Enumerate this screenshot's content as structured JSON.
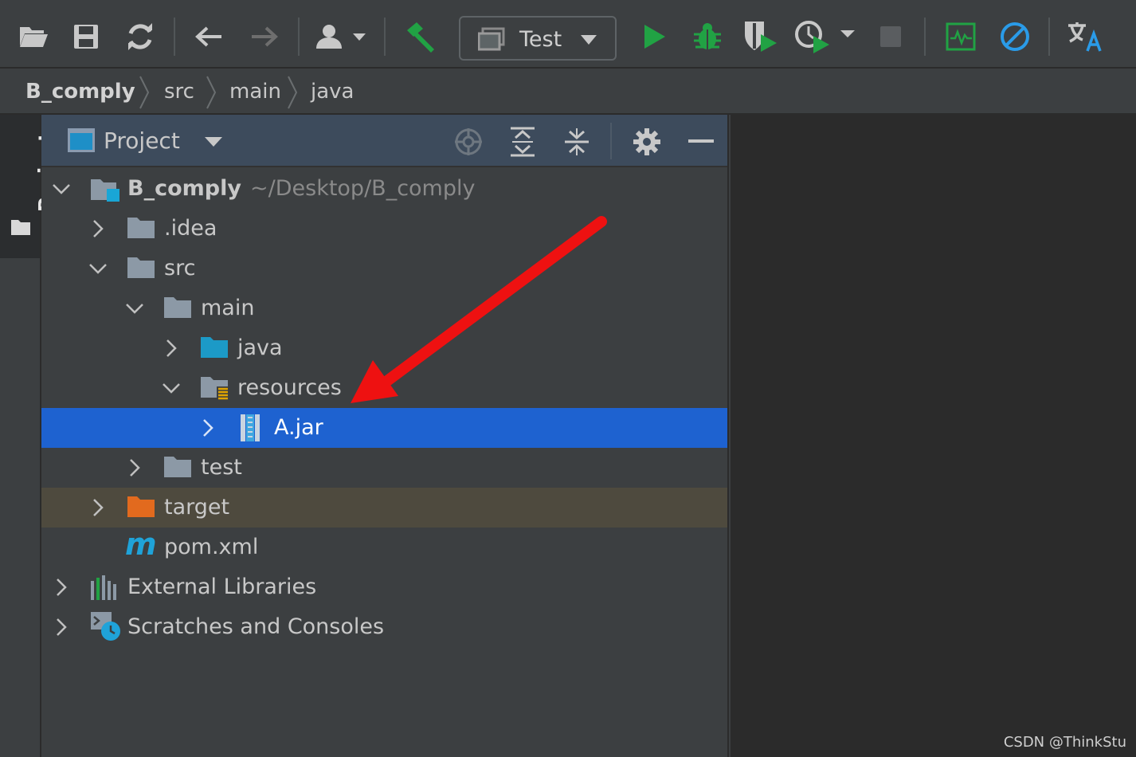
{
  "toolbar": {
    "items": [
      {
        "name": "open-folder-icon"
      },
      {
        "name": "save-icon"
      },
      {
        "name": "sync-icon"
      },
      {
        "name": "back-arrow-icon"
      },
      {
        "name": "forward-arrow-icon"
      },
      {
        "name": "user-dropdown-icon"
      },
      {
        "name": "build-hammer-icon"
      },
      {
        "name": "run-icon",
        "color": "#21a244"
      },
      {
        "name": "debug-icon",
        "color": "#21a244"
      },
      {
        "name": "coverage-icon"
      },
      {
        "name": "profiler-icon"
      },
      {
        "name": "stop-icon"
      },
      {
        "name": "activity-monitor-icon",
        "color": "#21a244"
      },
      {
        "name": "no-entry-icon",
        "color": "#2a9be8"
      },
      {
        "name": "translate-icon"
      }
    ],
    "run_config": {
      "label": "Test",
      "icon": "window-icon"
    }
  },
  "breadcrumb": {
    "items": [
      "B_comply",
      "src",
      "main",
      "java"
    ]
  },
  "left_stripe": {
    "tab_label": "Project",
    "tab_icon": "folder-icon"
  },
  "project_panel": {
    "title": "Project",
    "header_icons": [
      "locate-icon",
      "expand-all-icon",
      "collapse-all-icon",
      "gear-icon",
      "minimize-icon"
    ],
    "tree": [
      {
        "label": "B_comply",
        "path": "~/Desktop/B_comply",
        "icon": "module-folder-icon",
        "expanded": true,
        "bold": true
      },
      {
        "label": ".idea",
        "icon": "folder-icon",
        "expanded": false
      },
      {
        "label": "src",
        "icon": "folder-icon",
        "expanded": true
      },
      {
        "label": "main",
        "icon": "folder-icon",
        "expanded": true
      },
      {
        "label": "java",
        "icon": "source-folder-icon",
        "expanded": false
      },
      {
        "label": "resources",
        "icon": "resources-folder-icon",
        "expanded": true
      },
      {
        "label": "A.jar",
        "icon": "jar-icon",
        "expanded": false,
        "selected": true
      },
      {
        "label": "test",
        "icon": "folder-icon",
        "expanded": false
      },
      {
        "label": "target",
        "icon": "excluded-folder-icon",
        "expanded": false,
        "excluded": true
      },
      {
        "label": "pom.xml",
        "icon": "maven-icon"
      },
      {
        "label": "External Libraries",
        "icon": "libraries-icon",
        "expanded": false
      },
      {
        "label": "Scratches and Consoles",
        "icon": "scratches-icon",
        "expanded": false
      }
    ]
  },
  "colors": {
    "selection": "#1e62d0",
    "excluded_row": "#4e4a3e",
    "annotation_arrow": "#ee1111"
  },
  "watermark": "CSDN @ThinkStu"
}
